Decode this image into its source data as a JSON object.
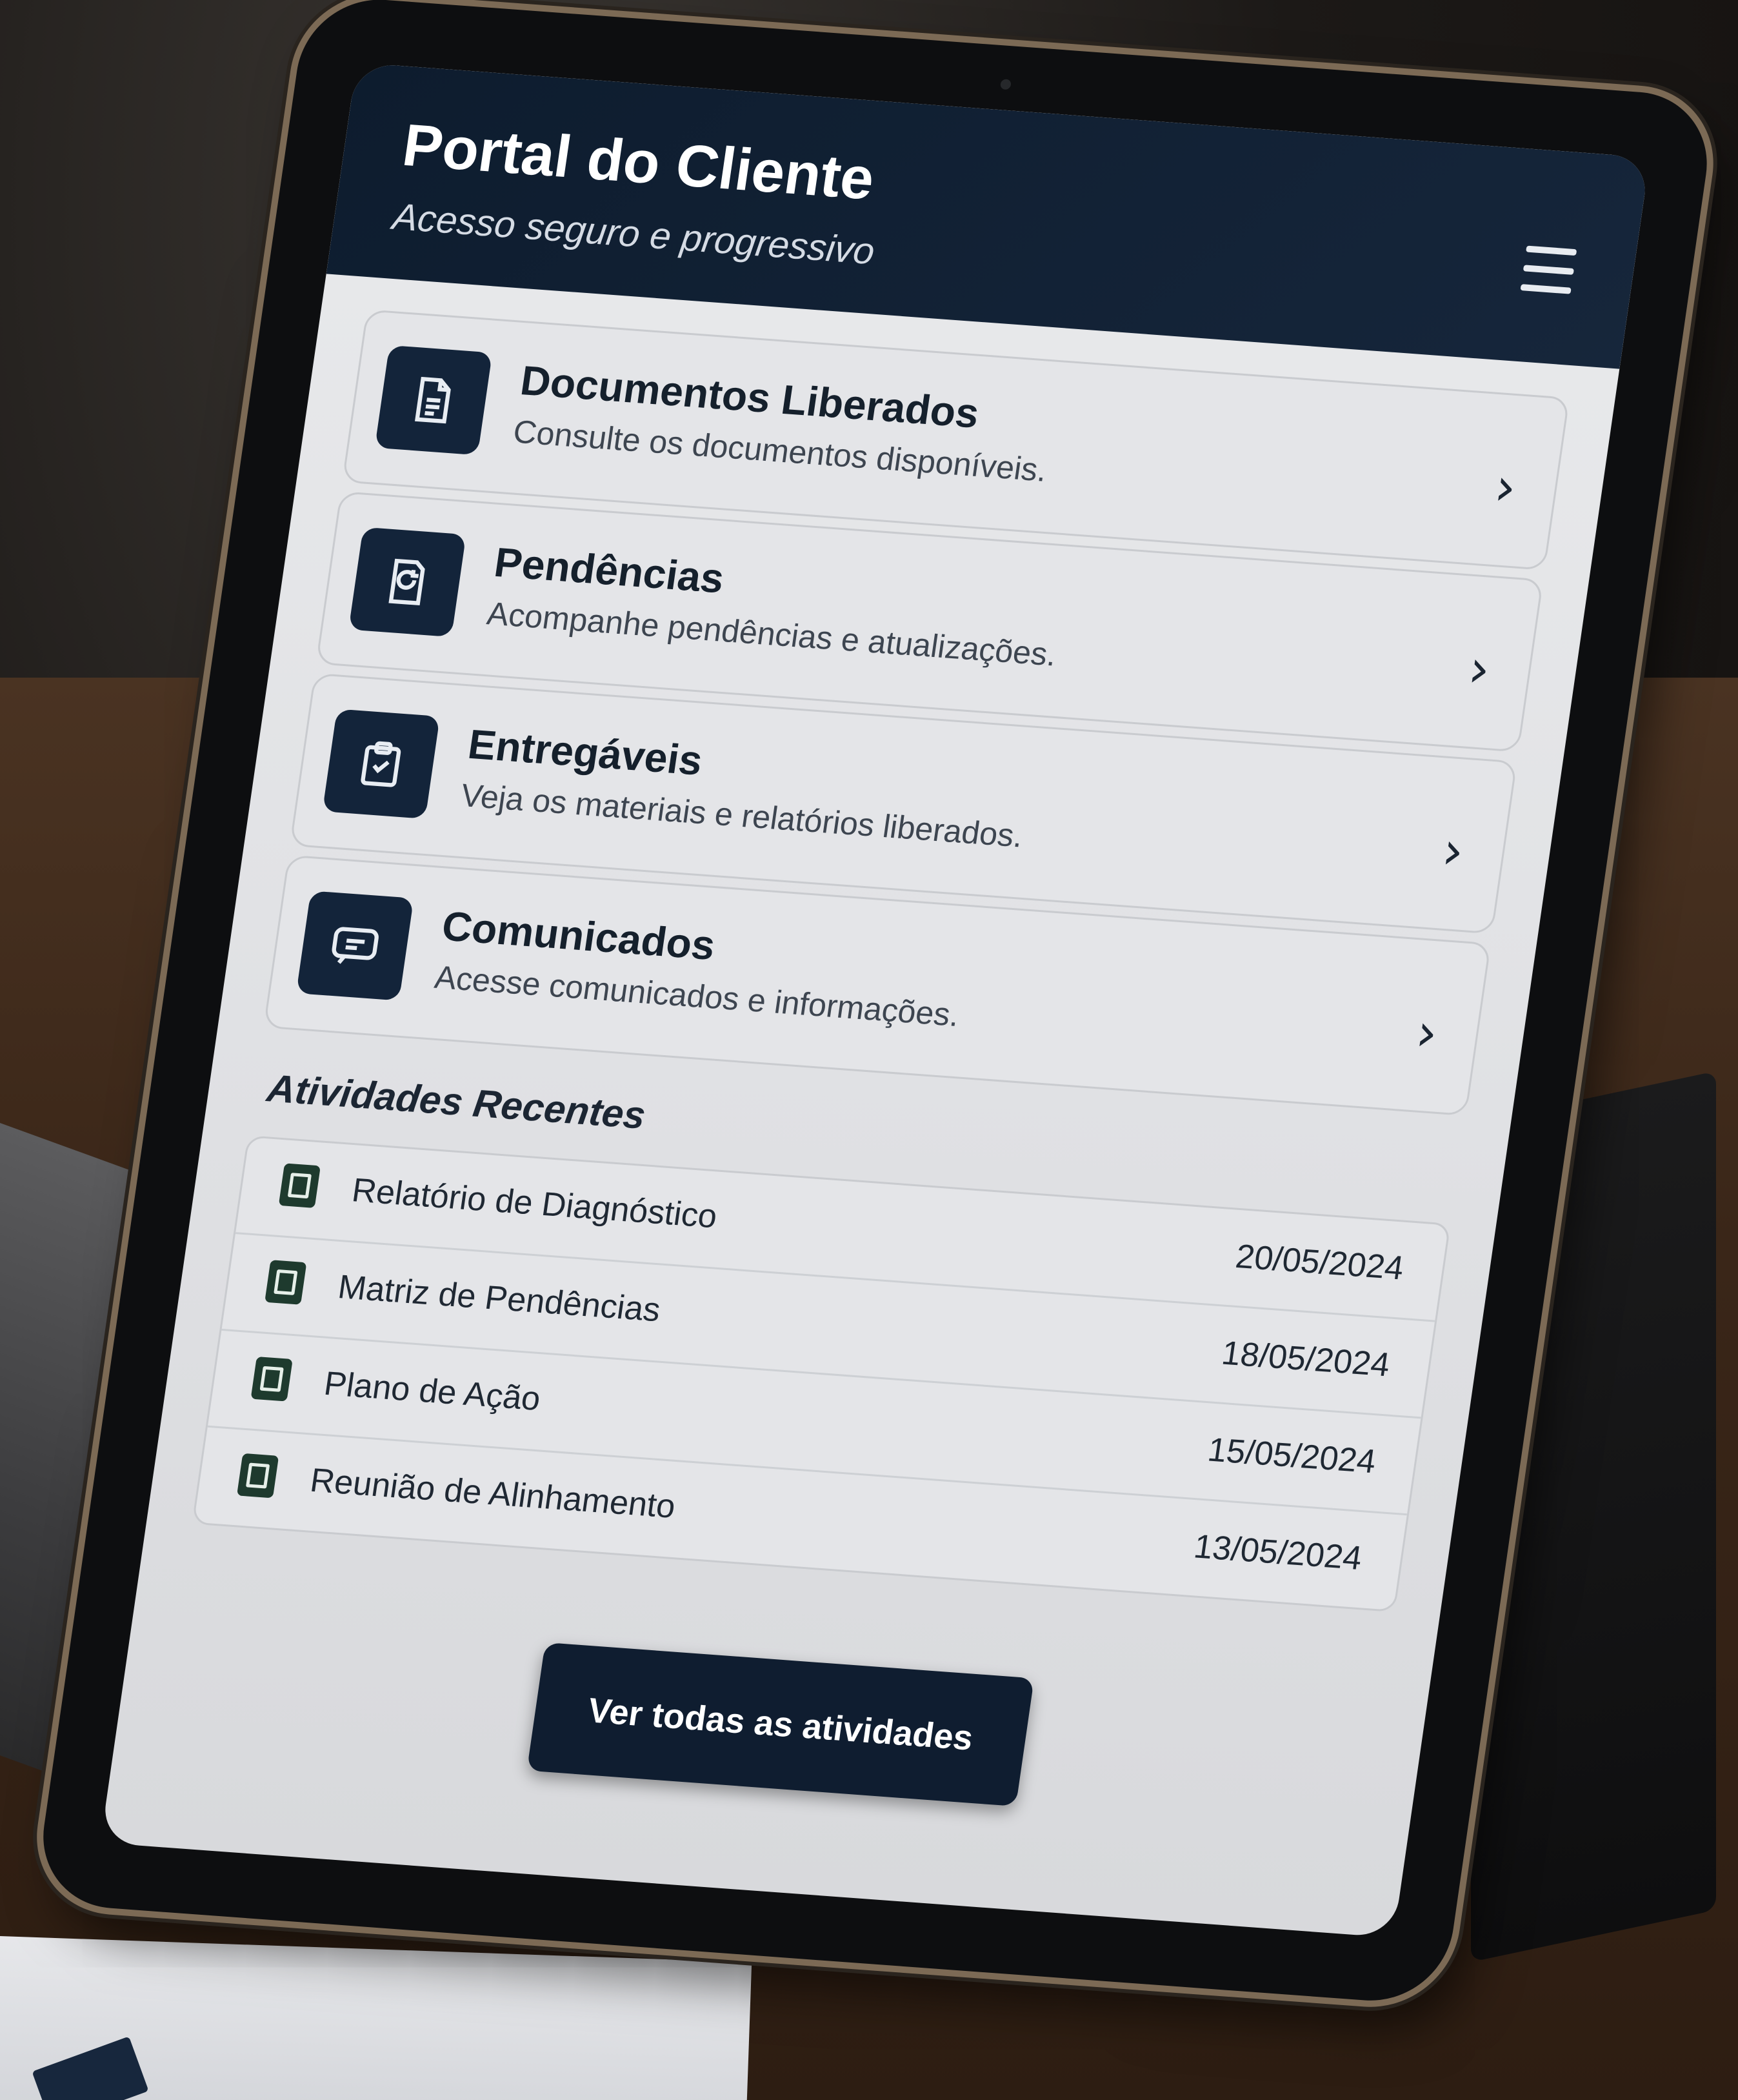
{
  "header": {
    "title": "Portal do Cliente",
    "subtitle": "Acesso seguro e progressivo",
    "menu_icon": "hamburger-menu-icon"
  },
  "cards": [
    {
      "title": "Documentos Liberados",
      "description": "Consulte os documentos disponíveis.",
      "icon": "document-icon"
    },
    {
      "title": "Pendências",
      "description": "Acompanhe pendências e atualizações.",
      "icon": "refresh-document-icon"
    },
    {
      "title": "Entregáveis",
      "description": "Veja os materiais e relatórios liberados.",
      "icon": "clipboard-icon"
    },
    {
      "title": "Comunicados",
      "description": "Acesse comunicados e informações.",
      "icon": "message-icon"
    }
  ],
  "recent": {
    "title": "Atividades Recentes",
    "items": [
      {
        "name": "Relatório de Diagnóstico",
        "date": "20/05/2024"
      },
      {
        "name": "Matriz de Pendências",
        "date": "18/05/2024"
      },
      {
        "name": "Plano de Ação",
        "date": "15/05/2024"
      },
      {
        "name": "Reunião de Alinhamento",
        "date": "13/05/2024"
      }
    ]
  },
  "cta": {
    "label": "Ver todas as atividades"
  },
  "colors": {
    "header_bg": "#0d1c2e",
    "icon_bg": "#13243a",
    "screen_bg": "#e9eaec",
    "button_bg": "#0f1d30",
    "file_icon": "#1e3a2e"
  }
}
